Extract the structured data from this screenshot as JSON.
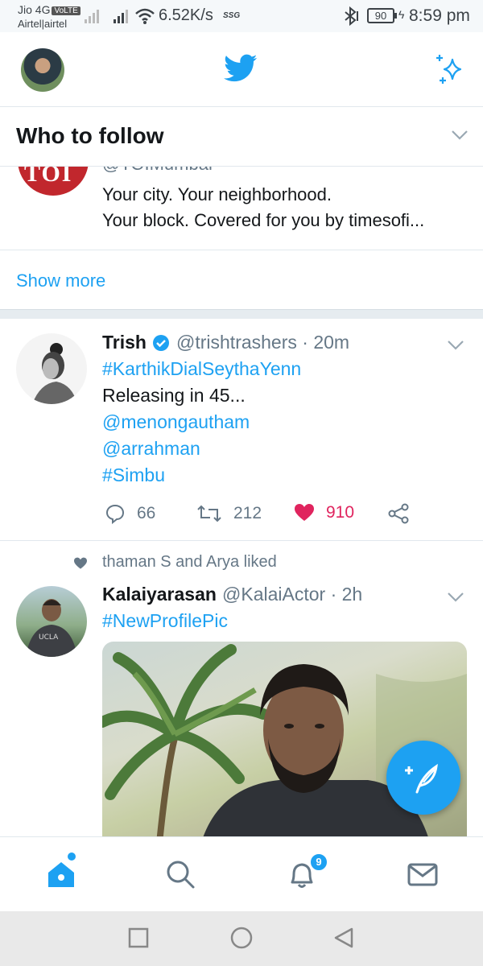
{
  "status_bar": {
    "carrier_line1": "Jio 4G",
    "volte": "VoLTE",
    "carrier_line2": "Airtel|airtel",
    "network_speed": "6.52K/s",
    "ssg": "SSG",
    "battery": "90",
    "time": "8:59 pm"
  },
  "header": {
    "avatar_icon": "profile-avatar",
    "logo_icon": "twitter-bird-icon",
    "sparkle_icon": "sparkle-icon"
  },
  "who_to_follow": {
    "title": "Who to follow",
    "suggestion": {
      "logo_text": "TOI",
      "handle": "@TOIMumbai",
      "bio_line1": "Your city. Your neighborhood.",
      "bio_line2": "Your block. Covered for you by timesofi..."
    },
    "show_more": "Show more"
  },
  "tweets": [
    {
      "name": "Trish",
      "verified": true,
      "handle": "@trishtrashers",
      "time": "· 20m",
      "lines": [
        "#KarthikDialSeythaYenn",
        "Releasing in 45...",
        "@menongautham",
        "@arrahman",
        "#Simbu"
      ],
      "replies": "66",
      "retweets": "212",
      "likes": "910"
    },
    {
      "context": "thaman S and Arya liked",
      "name": "Kalaiyarasan",
      "handle": "@KalaiActor",
      "time": "· 2h",
      "lines": [
        "#NewProfilePic"
      ],
      "avatar_shirt_text": "UCLA"
    }
  ],
  "bottom_nav": {
    "items": [
      "home-icon",
      "search-icon",
      "bell-icon",
      "mail-icon"
    ],
    "notifications_badge": "9"
  },
  "colors": {
    "accent": "#1da1f2",
    "like": "#e0245e",
    "muted": "#657786"
  }
}
